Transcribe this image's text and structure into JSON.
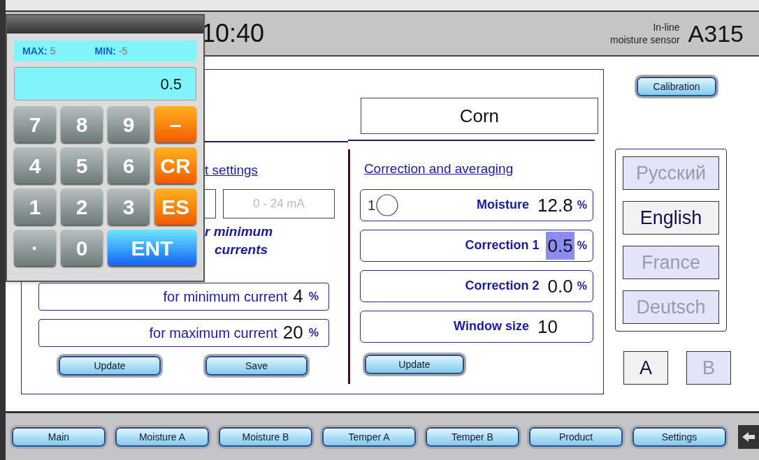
{
  "header": {
    "time": "10:40",
    "caption_lines": [
      "In-line",
      "moisture sensor"
    ],
    "model": "A315"
  },
  "keypad": {
    "max_label": "MAX:",
    "max_value": "5",
    "min_label": "MIN:",
    "min_value": "-5",
    "display": "0.5",
    "keys": [
      {
        "label": "7",
        "kind": "digit"
      },
      {
        "label": "8",
        "kind": "digit"
      },
      {
        "label": "9",
        "kind": "digit"
      },
      {
        "label": "–",
        "kind": "function"
      },
      {
        "label": "4",
        "kind": "digit"
      },
      {
        "label": "5",
        "kind": "digit"
      },
      {
        "label": "6",
        "kind": "digit"
      },
      {
        "label": "CR",
        "kind": "function"
      },
      {
        "label": "1",
        "kind": "digit"
      },
      {
        "label": "2",
        "kind": "digit"
      },
      {
        "label": "3",
        "kind": "digit"
      },
      {
        "label": "ES",
        "kind": "function"
      },
      {
        "label": "·",
        "kind": "digit"
      },
      {
        "label": "0",
        "kind": "digit"
      },
      {
        "label": "ENT",
        "kind": "enter"
      }
    ]
  },
  "product": "Corn",
  "output_settings": {
    "heading": "t settings",
    "range": "0 - 24 mA",
    "note_lines": [
      "r minimum",
      "currents"
    ],
    "rows": [
      {
        "label": "for minimum current",
        "value": "4",
        "unit": "%"
      },
      {
        "label": "for maximum current",
        "value": "20",
        "unit": "%"
      }
    ],
    "buttons": [
      "Update",
      "Save"
    ]
  },
  "correction": {
    "heading": "Correction and averaging",
    "rows": [
      {
        "kind": "indicator",
        "index": "1",
        "label": "Moisture",
        "value": "12.8",
        "unit": "%",
        "selected": false
      },
      {
        "kind": "value",
        "label": "Correction 1",
        "value": "0.5",
        "unit": "%",
        "selected": true
      },
      {
        "kind": "value",
        "label": "Correction 2",
        "value": "0.0",
        "unit": "%",
        "selected": false
      },
      {
        "kind": "value",
        "label": "Window size",
        "value": "10",
        "selected": false
      }
    ],
    "buttons": [
      "Update"
    ]
  },
  "calibration": "Calibration",
  "languages": [
    {
      "label": "Русский",
      "selected": false
    },
    {
      "label": "English",
      "selected": true
    },
    {
      "label": "France",
      "selected": false
    },
    {
      "label": "Deutsch",
      "selected": false
    }
  ],
  "channels": [
    {
      "label": "A",
      "selected": true
    },
    {
      "label": "B",
      "selected": false
    }
  ],
  "nav": [
    "Main",
    "Moisture A",
    "Moisture B",
    "Temper A",
    "Temper B",
    "Product",
    "Settings"
  ]
}
